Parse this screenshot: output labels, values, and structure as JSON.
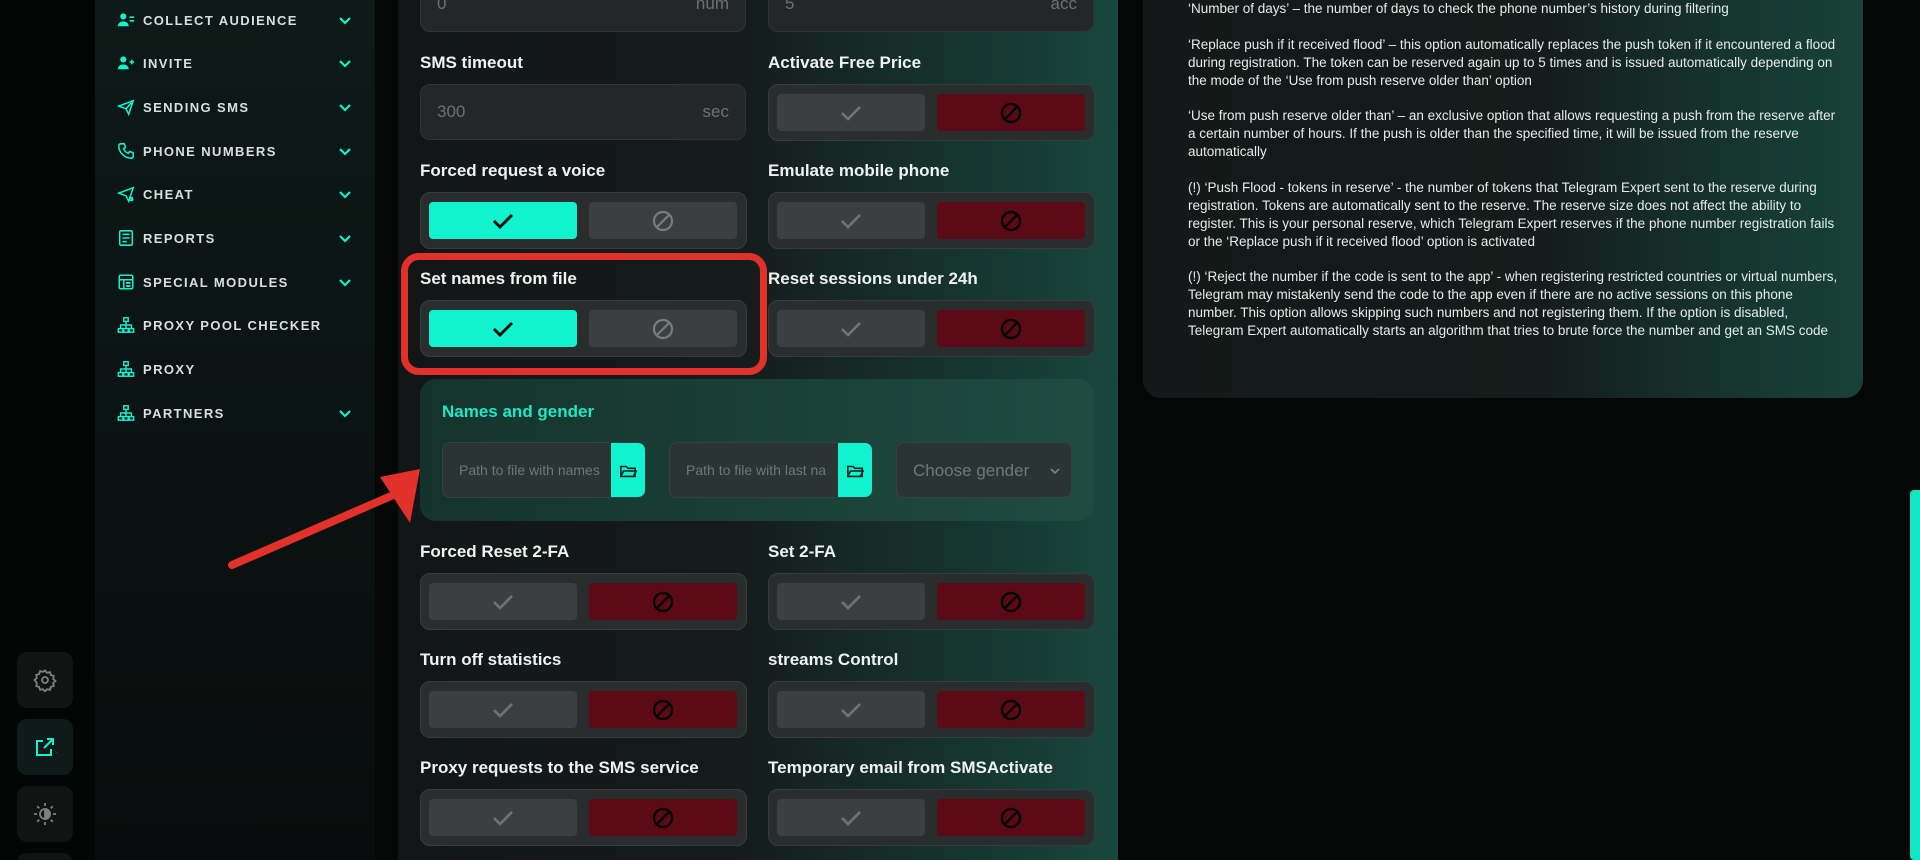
{
  "rail": {
    "buttons": [
      "gear-icon",
      "external-link-icon",
      "theme-icon"
    ]
  },
  "sidebar": {
    "items": [
      {
        "label": "COLLECT AUDIENCE",
        "icon": "users-icon",
        "expandable": true
      },
      {
        "label": "INVITE",
        "icon": "user-plus-icon",
        "expandable": true
      },
      {
        "label": "SENDING SMS",
        "icon": "paper-plane-icon",
        "expandable": true
      },
      {
        "label": "PHONE NUMBERS",
        "icon": "phone-icon",
        "expandable": true
      },
      {
        "label": "CHEAT",
        "icon": "send-boost-icon",
        "expandable": true
      },
      {
        "label": "REPORTS",
        "icon": "report-icon",
        "expandable": true
      },
      {
        "label": "SPECIAL MODULES",
        "icon": "modules-icon",
        "expandable": true
      },
      {
        "label": "PROXY POOL CHECKER",
        "icon": "network-icon",
        "expandable": false
      },
      {
        "label": "PROXY",
        "icon": "network-icon",
        "expandable": false
      },
      {
        "label": "PARTNERS",
        "icon": "network-icon",
        "expandable": true
      }
    ]
  },
  "main": {
    "top_inputs": [
      {
        "value": "0",
        "unit": "num"
      },
      {
        "value": "5",
        "unit": "acc"
      }
    ],
    "sms_timeout": {
      "label": "SMS timeout",
      "placeholder": "300",
      "unit": "sec"
    },
    "toggles": {
      "activate_free_price": {
        "label": "Activate Free Price",
        "state": "off"
      },
      "forced_request_voice": {
        "label": "Forced request a voice",
        "state": "on"
      },
      "emulate_mobile_phone": {
        "label": "Emulate mobile phone",
        "state": "off"
      },
      "set_names_from_file": {
        "label": "Set names from file",
        "state": "on"
      },
      "reset_sessions_24h": {
        "label": "Reset sessions under 24h",
        "state": "off"
      },
      "forced_reset_2fa": {
        "label": "Forced Reset 2-FA",
        "state": "off"
      },
      "set_2fa": {
        "label": "Set 2-FA",
        "state": "off"
      },
      "turn_off_statistics": {
        "label": "Turn off statistics",
        "state": "off"
      },
      "streams_control": {
        "label": "streams Control",
        "state": "off"
      },
      "proxy_requests_sms": {
        "label": "Proxy requests to the SMS service",
        "state": "off"
      },
      "temporary_email": {
        "label": "Temporary email from SMSActivate",
        "state": "off"
      }
    },
    "names_and_gender": {
      "title": "Names and gender",
      "names_placeholder": "Path to file with names",
      "lastnames_placeholder": "Path to file with last na",
      "gender_placeholder": "Choose gender"
    }
  },
  "help": {
    "paragraphs": [
      "‘Number of days’ – the number of days to check the phone number’s history during filtering",
      "‘Replace push if it received flood’ – this option automatically replaces the push token if it encountered a flood during registration. The token can be reserved again up to 5 times and is issued automatically depending on the mode of the ‘Use from push reserve older than’ option",
      "‘Use from push reserve older than’ – an exclusive option that allows requesting a push from the reserve after a certain number of hours. If the push is older than the specified time, it will be issued from the reserve automatically",
      "(!) ‘Push Flood - tokens in reserve’ - the number of tokens that Telegram Expert sent to the reserve during registration. Tokens are automatically sent to the reserve. The reserve size does not affect the ability to register. This is your personal reserve, which Telegram Expert reserves if the phone number registration fails or the ‘Replace push if it received flood’ option is activated",
      "(!) ‘Reject the number if the code is sent to the app’ - when registering restricted countries or virtual numbers, Telegram may mistakenly send the code to the app even if there are no active sessions on this phone number. This option allows skipping such numbers and not registering them. If the option is disabled, Telegram Expert automatically starts an algorithm that tries to brute force the number and get an SMS code"
    ]
  },
  "colors": {
    "accent": "#11f2cf",
    "danger": "#5c0a16",
    "highlight": "#e2302a"
  }
}
